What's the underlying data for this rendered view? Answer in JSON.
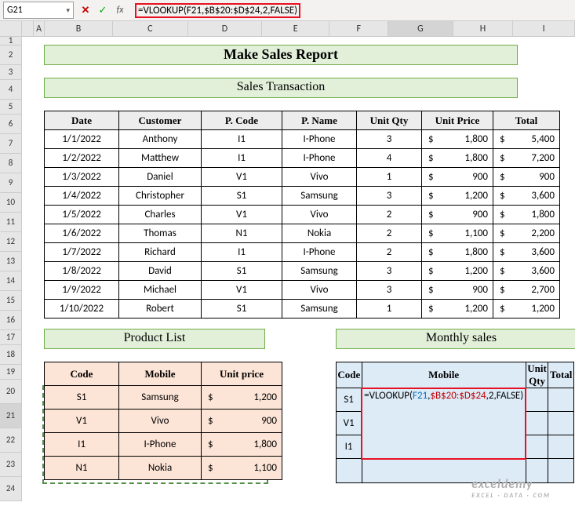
{
  "nameBox": "G21",
  "formula": "=VLOOKUP(F21,$B$20:$D$24,2,FALSE)",
  "colHeaders": [
    "A",
    "B",
    "C",
    "D",
    "E",
    "F",
    "G",
    "H",
    "I"
  ],
  "rowHeaders": [
    1,
    2,
    3,
    4,
    5,
    6,
    7,
    8,
    9,
    10,
    11,
    12,
    13,
    14,
    15,
    16,
    17,
    18,
    19,
    20,
    21,
    22,
    23,
    24
  ],
  "activeRow": 21,
  "activeCol": "G",
  "titles": {
    "main": "Make Sales Report",
    "section1": "Sales Transaction",
    "section2": "Product List",
    "section3": "Monthly sales"
  },
  "table1": {
    "headers": [
      "Date",
      "Customer",
      "P. Code",
      "P. Name",
      "Unit Qty",
      "Unit Price",
      "Total"
    ],
    "rows": [
      [
        "1/1/2022",
        "Anthony",
        "I1",
        "I-Phone",
        "3",
        "1,800",
        "5,400"
      ],
      [
        "1/2/2022",
        "Matthew",
        "I1",
        "I-Phone",
        "4",
        "1,800",
        "7,200"
      ],
      [
        "1/3/2022",
        "Daniel",
        "V1",
        "Vivo",
        "1",
        "900",
        "900"
      ],
      [
        "1/4/2022",
        "Christopher",
        "S1",
        "Samsung",
        "3",
        "1,200",
        "3,600"
      ],
      [
        "1/5/2022",
        "Charles",
        "V1",
        "Vivo",
        "2",
        "900",
        "1,800"
      ],
      [
        "1/6/2022",
        "Thomas",
        "N1",
        "Nokia",
        "2",
        "1,100",
        "2,200"
      ],
      [
        "1/7/2022",
        "Richard",
        "I1",
        "I-Phone",
        "2",
        "1,800",
        "3,600"
      ],
      [
        "1/8/2022",
        "David",
        "S1",
        "Samsung",
        "3",
        "1,200",
        "3,600"
      ],
      [
        "1/9/2022",
        "Michael",
        "V1",
        "Vivo",
        "3",
        "900",
        "2,700"
      ],
      [
        "1/10/2022",
        "Robert",
        "S1",
        "Samsung",
        "1",
        "1,200",
        "1,200"
      ]
    ]
  },
  "table2": {
    "headers": [
      "Code",
      "Mobile",
      "Unit price"
    ],
    "rows": [
      [
        "S1",
        "Samsung",
        "1,200"
      ],
      [
        "V1",
        "Vivo",
        "900"
      ],
      [
        "I1",
        "I-Phone",
        "1,800"
      ],
      [
        "N1",
        "Nokia",
        "1,100"
      ]
    ]
  },
  "table3": {
    "headers": [
      "Code",
      "Mobile",
      "Unit Qty",
      "Total"
    ],
    "codes": [
      "S1",
      "V1",
      "I1",
      ""
    ],
    "editingFormula": {
      "pre": "=VLOOKUP(",
      "ref1": "F21",
      "sep1": ",",
      "ref2": "$B$20:$D$24",
      "sep2": ",2,FALSE)"
    }
  },
  "chart_data": {
    "type": "table",
    "title": "Sales Transaction",
    "columns": [
      "Date",
      "Customer",
      "P. Code",
      "P. Name",
      "Unit Qty",
      "Unit Price",
      "Total"
    ],
    "rows": [
      [
        "1/1/2022",
        "Anthony",
        "I1",
        "I-Phone",
        3,
        1800,
        5400
      ],
      [
        "1/2/2022",
        "Matthew",
        "I1",
        "I-Phone",
        4,
        1800,
        7200
      ],
      [
        "1/3/2022",
        "Daniel",
        "V1",
        "Vivo",
        1,
        900,
        900
      ],
      [
        "1/4/2022",
        "Christopher",
        "S1",
        "Samsung",
        3,
        1200,
        3600
      ],
      [
        "1/5/2022",
        "Charles",
        "V1",
        "Vivo",
        2,
        900,
        1800
      ],
      [
        "1/6/2022",
        "Thomas",
        "N1",
        "Nokia",
        2,
        1100,
        2200
      ],
      [
        "1/7/2022",
        "Richard",
        "I1",
        "I-Phone",
        2,
        1800,
        3600
      ],
      [
        "1/8/2022",
        "David",
        "S1",
        "Samsung",
        3,
        1200,
        3600
      ],
      [
        "1/9/2022",
        "Michael",
        "V1",
        "Vivo",
        3,
        900,
        2700
      ],
      [
        "1/10/2022",
        "Robert",
        "S1",
        "Samsung",
        1,
        1200,
        1200
      ]
    ]
  },
  "watermark": {
    "main": "exceldemy",
    "sub": "EXCEL · DATA · COM"
  }
}
